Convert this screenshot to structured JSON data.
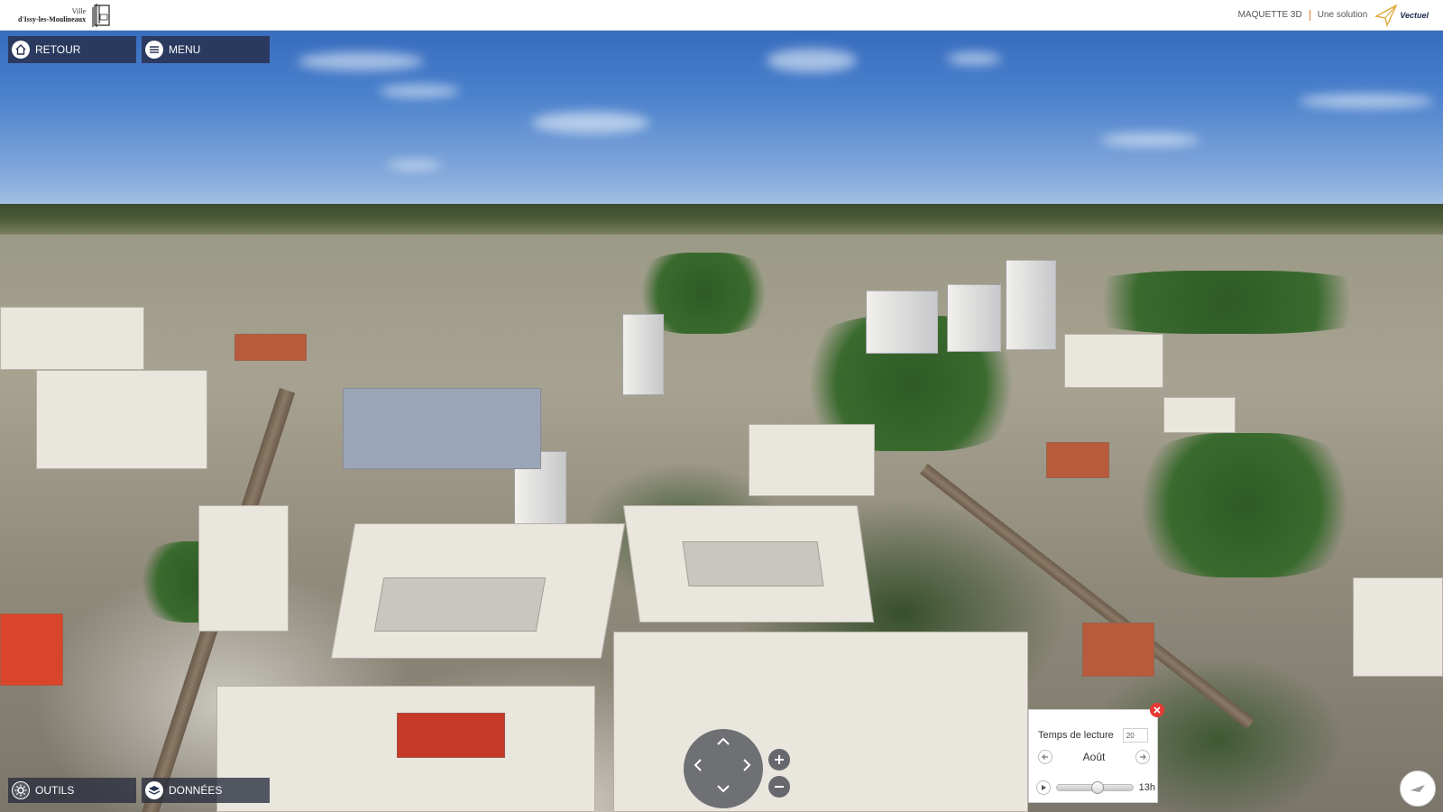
{
  "topbar": {
    "city_name_line1": "Ville",
    "city_name_line2": "d'Issy-les-Moulineaux",
    "product": "MAQUETTE 3D",
    "solution_label": "Une solution",
    "brand": "Vectuel",
    "accent_color": "#e07a2a"
  },
  "panels": {
    "retour_label": "RETOUR",
    "menu_label": "MENU",
    "outils_label": "OUTILS",
    "donnees_label": "DONNÉES",
    "panel_color": "#283250"
  },
  "icons": {
    "retour": "home-icon",
    "menu": "hamburger-icon",
    "outils": "gear-icon",
    "donnees": "layers-icon",
    "navigation": [
      "arrow-up-icon",
      "arrow-down-icon",
      "arrow-left-icon",
      "arrow-right-icon"
    ],
    "zoom": [
      "plus-icon",
      "minus-icon"
    ],
    "time_panel": [
      "close-icon",
      "prev-month-icon",
      "next-month-icon",
      "play-icon"
    ],
    "compass": "compass-icon"
  },
  "time_panel": {
    "title": "Temps de lecture",
    "duration_value": "20",
    "month": "Août",
    "hour": "13h",
    "close_color": "#e53935"
  },
  "scene": {
    "type": "3D aerial city model",
    "sky_color": "#3b6fc0"
  }
}
